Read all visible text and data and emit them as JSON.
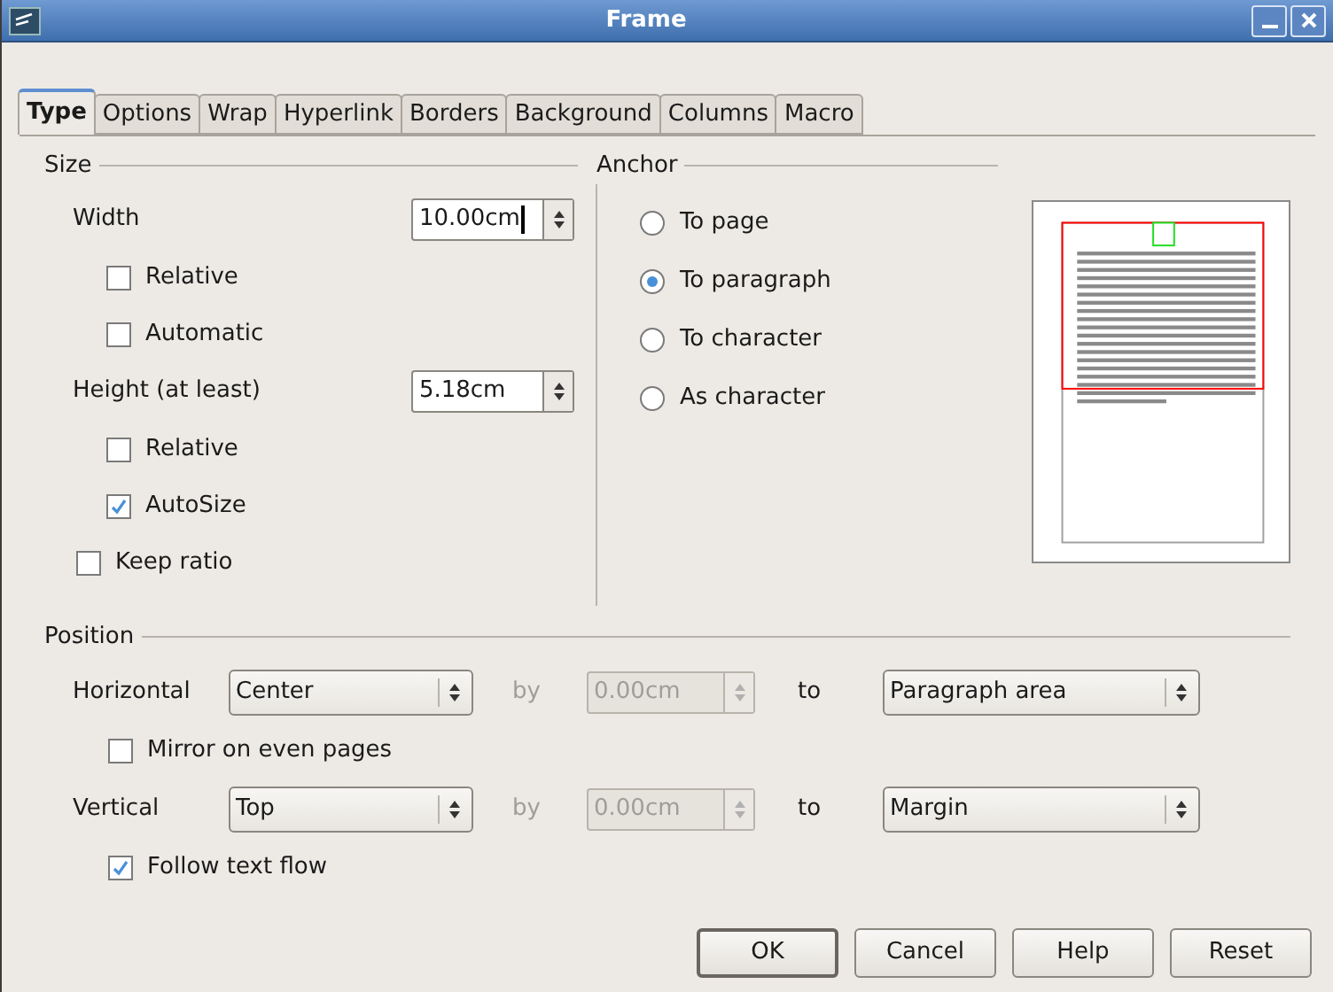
{
  "window": {
    "title": "Frame"
  },
  "tabs": [
    {
      "label": "Type",
      "selected": true
    },
    {
      "label": "Options",
      "selected": false
    },
    {
      "label": "Wrap",
      "selected": false
    },
    {
      "label": "Hyperlink",
      "selected": false
    },
    {
      "label": "Borders",
      "selected": false
    },
    {
      "label": "Background",
      "selected": false
    },
    {
      "label": "Columns",
      "selected": false
    },
    {
      "label": "Macro",
      "selected": false
    }
  ],
  "size": {
    "title": "Size",
    "items": [
      {
        "kind": "spin",
        "label": "Width",
        "value": "10.00cm",
        "focused": true
      },
      {
        "kind": "sub_check",
        "label": "Relative",
        "checked": false
      },
      {
        "kind": "sub_check",
        "label": "Automatic",
        "checked": false
      },
      {
        "kind": "spin",
        "label": "Height (at least)",
        "value": "5.18cm",
        "focused": false
      },
      {
        "kind": "sub_check",
        "label": "Relative",
        "checked": false
      },
      {
        "kind": "sub_check",
        "label": "AutoSize",
        "checked": true
      },
      {
        "kind": "check",
        "label": "Keep ratio",
        "checked": false
      }
    ]
  },
  "anchor": {
    "title": "Anchor",
    "options": [
      {
        "label": "To page",
        "selected": false
      },
      {
        "label": "To paragraph",
        "selected": true
      },
      {
        "label": "To character",
        "selected": false
      },
      {
        "label": "As character",
        "selected": false
      }
    ]
  },
  "position": {
    "title": "Position",
    "rows": [
      {
        "label": "Horizontal",
        "select": "Center",
        "by_label": "by",
        "by_value": "0.00cm",
        "disabled": true,
        "to_label": "to",
        "to_select": "Paragraph area",
        "check": {
          "label": "Mirror on even pages",
          "checked": false
        }
      },
      {
        "label": "Vertical",
        "select": "Top",
        "by_label": "by",
        "by_value": "0.00cm",
        "disabled": true,
        "to_label": "to",
        "to_select": "Margin",
        "check": {
          "label": "Follow text flow",
          "checked": true
        }
      }
    ]
  },
  "buttons": [
    {
      "label": "OK",
      "default": true
    },
    {
      "label": "Cancel",
      "default": false
    },
    {
      "label": "Help",
      "default": false
    },
    {
      "label": "Reset",
      "default": false
    }
  ]
}
